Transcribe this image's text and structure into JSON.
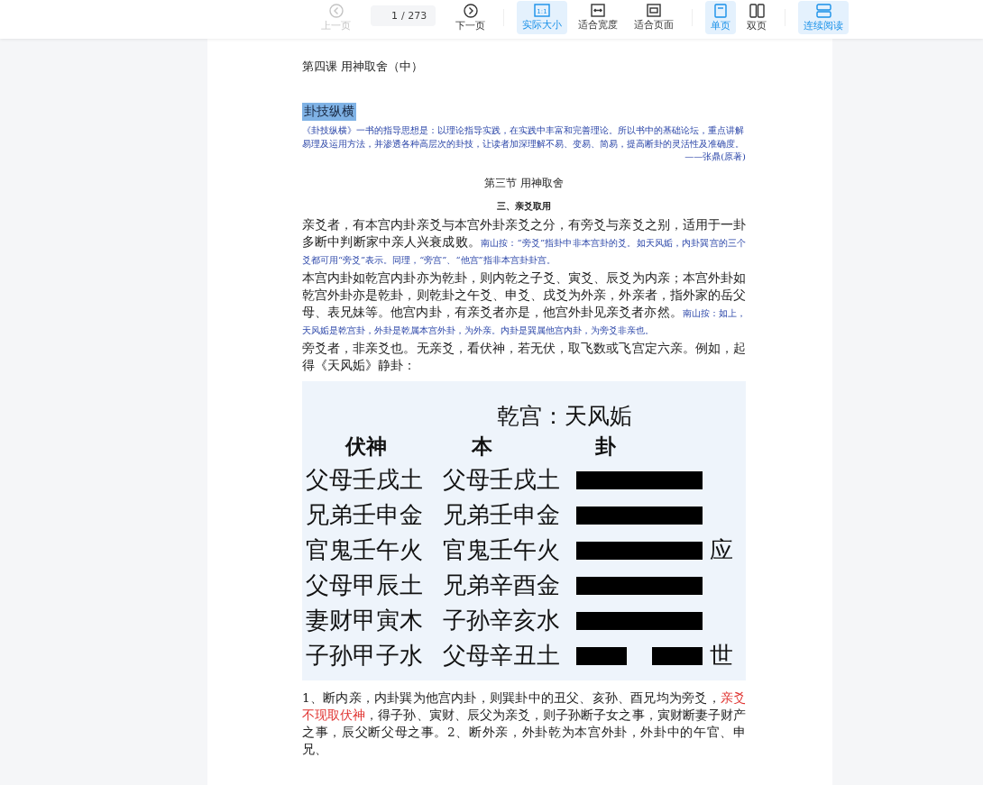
{
  "toolbar": {
    "items": [
      {
        "kind": "prev",
        "label": "上一页",
        "disabled": true
      },
      {
        "kind": "page",
        "value": "1",
        "total": "/ 273"
      },
      {
        "kind": "next",
        "label": "下一页",
        "disabled": false
      },
      {
        "kind": "divider"
      },
      {
        "kind": "actual",
        "label": "实际大小",
        "icon_label": "1:1",
        "selected": true
      },
      {
        "kind": "fit-width",
        "label": "适合宽度",
        "selected": false
      },
      {
        "kind": "fit-page",
        "label": "适合页面",
        "selected": false
      },
      {
        "kind": "divider"
      },
      {
        "kind": "single",
        "label": "单页",
        "selected": true
      },
      {
        "kind": "double",
        "label": "双页",
        "selected": false
      },
      {
        "kind": "divider"
      },
      {
        "kind": "continuous",
        "label": "连续阅读",
        "selected": true
      }
    ]
  },
  "document": {
    "lesson_title": "第四课 用神取舍（中）",
    "highlight_title": "卦技纵横",
    "intro": "《卦技纵横》一书的指导思想是：以理论指导实践，在实践中丰富和完善理论。所以书中的基础论坛，重点讲解易理及运用方法，并渗透各种高层次的卦技，让读者加深理解不易、变易、简易，提高断卦的灵活性及准确度。",
    "intro_author": "——张鼎(原著)",
    "section_title": "第三节 用神取舍",
    "subsection_title": "三、亲爻取用",
    "paragraphs": [
      [
        {
          "kind": "main",
          "text": "亲爻者，有本宫内卦亲爻与本宫外卦亲爻之分，有旁爻与亲爻之别，适用于一卦多断中判断家中亲人兴衰成败。"
        },
        {
          "kind": "note",
          "text": "南山按：“旁爻”指卦中非本宫卦的爻。如天风姤，内卦巽宫的三个爻都可用“旁爻”表示。同理，“旁宫”、“他宫”指非本宫卦卦宫。"
        }
      ],
      [
        {
          "kind": "main",
          "text": "本宫内卦如乾宫内卦亦为乾卦，则内乾之子爻、寅爻、辰爻为内亲；本宫外卦如乾宫外卦亦是乾卦，则乾卦之午爻、申爻、戌爻为外亲，外亲者，指外家的岳父母、表兄妹等。他宫内卦，有亲爻者亦是，他宫外卦见亲爻者亦然。"
        },
        {
          "kind": "note",
          "text": "南山按：如上，天风姤是乾宫卦，外卦是乾属本宫外卦，为外亲。内卦是巽属他宫内卦，为旁爻非亲也。"
        }
      ],
      [
        {
          "kind": "main",
          "text": "旁爻者，非亲爻也。无亲爻，看伏神，若无伏，取飞数或飞宫定六亲。例如，起得《天风姤》静卦："
        }
      ]
    ],
    "figure": {
      "title": "乾宫：天风姤",
      "headers": [
        "伏神",
        "本",
        "卦"
      ],
      "rows": [
        {
          "fushen": "父母壬戌土",
          "bengua": "父母壬戌土",
          "kind": "yang"
        },
        {
          "fushen": "兄弟壬申金",
          "bengua": "兄弟壬申金",
          "kind": "yang"
        },
        {
          "fushen": "官鬼壬午火",
          "bengua": "官鬼壬午火",
          "kind": "yang",
          "mark": "应"
        },
        {
          "fushen": "父母甲辰土",
          "bengua": "兄弟辛酉金",
          "kind": "yang"
        },
        {
          "fushen": "妻财甲寅木",
          "bengua": "子孙辛亥水",
          "kind": "yang"
        },
        {
          "fushen": "子孙甲子水",
          "bengua": "父母辛丑土",
          "kind": "yin",
          "mark": "世"
        }
      ]
    },
    "closing": [
      {
        "kind": "main",
        "text": "1、断内亲，内卦巽为他宫内卦，则巽卦中的丑父、亥孙、酉兄均为旁爻，"
      },
      {
        "kind": "emphasis",
        "text": "亲爻不现取伏神"
      },
      {
        "kind": "main",
        "text": "，得子孙、寅财、辰父为亲爻，则子孙断子女之事，寅财断妻子财产之事，辰父断父母之事。2、断外亲，外卦乾为本宫外卦，外卦中的午官、申兄、"
      }
    ]
  }
}
